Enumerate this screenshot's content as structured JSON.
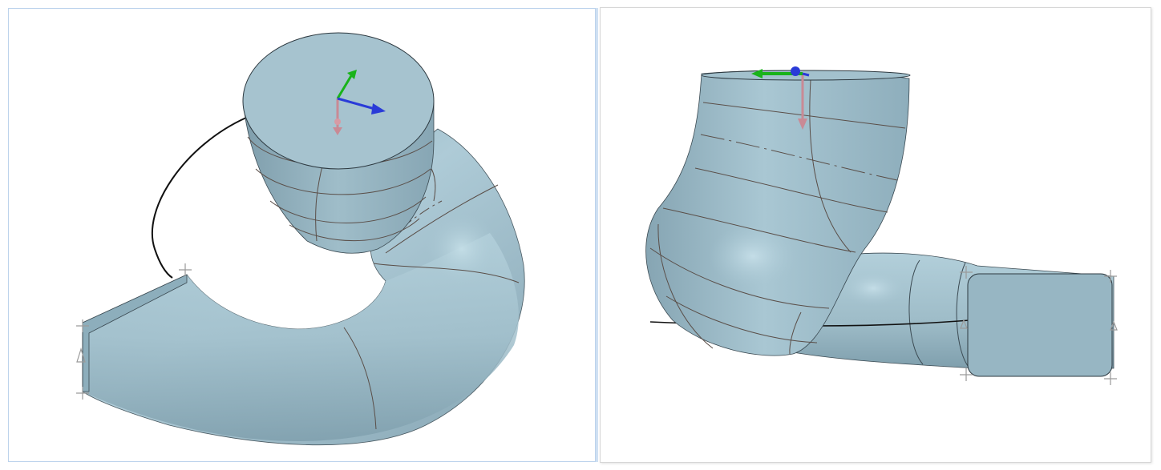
{
  "viewports": [
    {
      "name": "left-view",
      "model": "swept-spiral-duct",
      "colors": {
        "surface": "#a9c7d3",
        "surface_dark": "#7d9dab",
        "cap": "#a3c1cd",
        "edge": "#333333",
        "section_line": "#6b5e57",
        "guide_curve": "#111111",
        "triad_x": "#2a3bd8",
        "triad_y": "#19b31a",
        "triad_z": "#c98a95"
      }
    },
    {
      "name": "right-view",
      "model": "swept-elbow-duct",
      "colors": {
        "surface": "#a9c7d3",
        "surface_dark": "#7f9fad",
        "cap": "#9cb9c6",
        "edge": "#333333",
        "section_line": "#6b5e57",
        "guide_curve": "#111111",
        "triad_x": "#19b31a",
        "triad_y": "#2a3bd8",
        "triad_z": "#c98a95"
      }
    }
  ]
}
